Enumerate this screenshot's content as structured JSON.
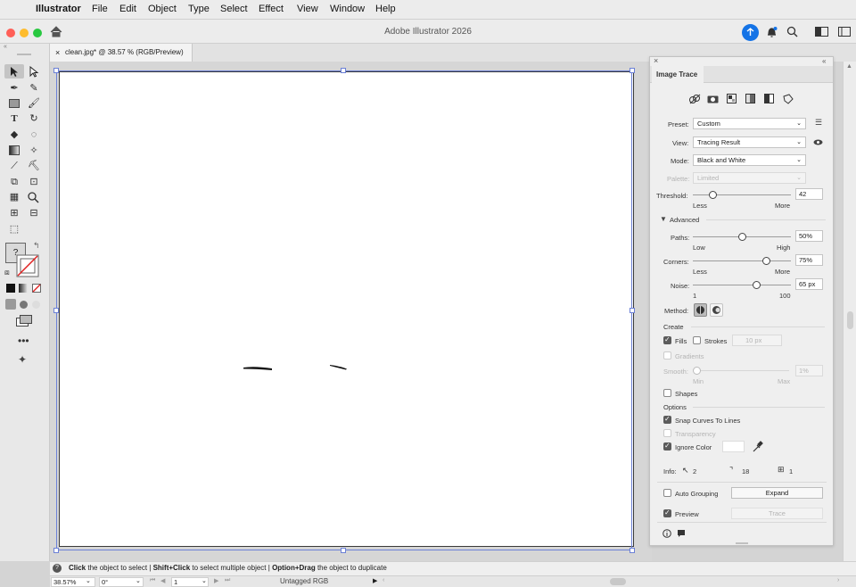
{
  "menubar": {
    "items": [
      "Illustrator",
      "File",
      "Edit",
      "Object",
      "Type",
      "Select",
      "Effect",
      "View",
      "Window",
      "Help"
    ]
  },
  "window": {
    "title": "Adobe Illustrator 2026"
  },
  "document": {
    "tab_label": "clean.jpg* @ 38.57 % (RGB/Preview)",
    "close": "×"
  },
  "status": {
    "help_icon": "?",
    "click_b": "Click",
    "click_t": " the object to select  |  ",
    "shift_b": "Shift+Click",
    "shift_t": " to select multiple object  |  ",
    "opt_b": "Option+Drag",
    "opt_t": " the object to duplicate"
  },
  "bottombar": {
    "zoom": "38.57%",
    "rotate": "0°",
    "artboard": "1",
    "color_profile": "Untagged RGB"
  },
  "toolbar": {
    "fill_stroke_question": "?"
  },
  "image_trace": {
    "title": "Image Trace",
    "preset_label": "Preset:",
    "preset_value": "Custom",
    "view_label": "View:",
    "view_value": "Tracing Result",
    "mode_label": "Mode:",
    "mode_value": "Black and White",
    "palette_label": "Palette:",
    "palette_value": "Limited",
    "threshold_label": "Threshold:",
    "threshold_value": "42",
    "threshold_min": "Less",
    "threshold_max": "More",
    "advanced_label": "Advanced",
    "paths_label": "Paths:",
    "paths_value": "50%",
    "paths_min": "Low",
    "paths_max": "High",
    "corners_label": "Corners:",
    "corners_value": "75%",
    "corners_min": "Less",
    "corners_max": "More",
    "noise_label": "Noise:",
    "noise_value": "65 px",
    "noise_min": "1",
    "noise_max": "100",
    "method_label": "Method:",
    "create_label": "Create",
    "fills_label": "Fills",
    "strokes_label": "Strokes",
    "stroke_width": "10 px",
    "gradients_label": "Gradients",
    "smooth_label": "Smooth:",
    "smooth_value": "1%",
    "smooth_min": "Min",
    "smooth_max": "Max",
    "shapes_label": "Shapes",
    "options_label": "Options",
    "snap_label": "Snap Curves To Lines",
    "transparency_label": "Transparency",
    "ignore_label": "Ignore Color",
    "info_label": "Info:",
    "info_paths": "2",
    "info_anchors": "18",
    "info_colors": "1",
    "auto_group_label": "Auto Grouping",
    "expand_label": "Expand",
    "preview_label": "Preview",
    "trace_label": "Trace"
  },
  "controls": {
    "threshold": 0.2,
    "paths": 0.5,
    "corners": 0.75,
    "noise": 0.65
  },
  "colors": {
    "accent": "#1473e6",
    "selection": "#6b80d6"
  }
}
